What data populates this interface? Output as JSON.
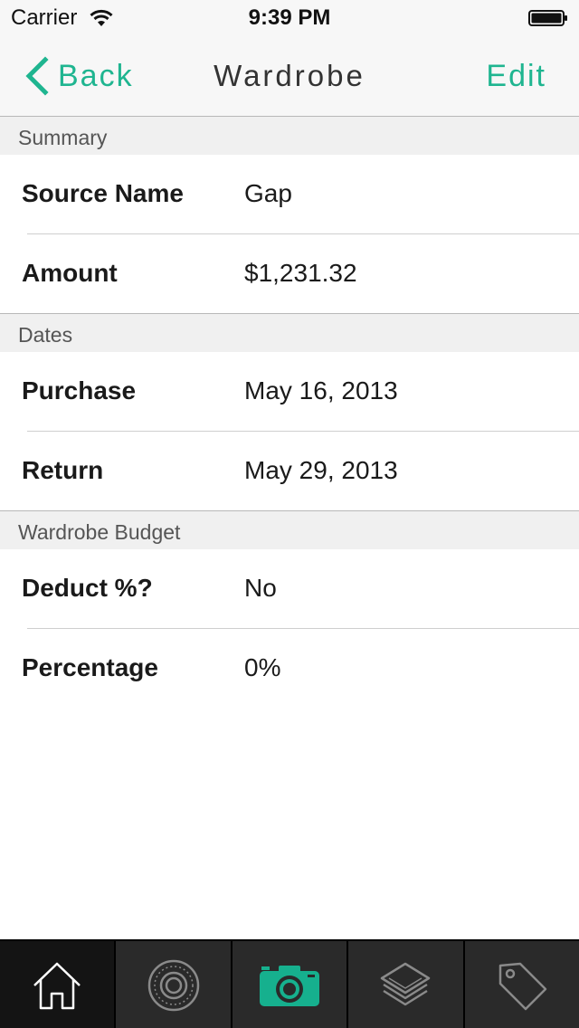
{
  "status_bar": {
    "carrier": "Carrier",
    "time": "9:39 PM"
  },
  "nav": {
    "back_label": "Back",
    "title": "Wardrobe",
    "edit_label": "Edit"
  },
  "sections": {
    "summary": {
      "header": "Summary",
      "source_name_label": "Source Name",
      "source_name_value": "Gap",
      "amount_label": "Amount",
      "amount_value": "$1,231.32"
    },
    "dates": {
      "header": "Dates",
      "purchase_label": "Purchase",
      "purchase_value": "May 16, 2013",
      "return_label": "Return",
      "return_value": "May 29, 2013"
    },
    "budget": {
      "header": "Wardrobe Budget",
      "deduct_label": "Deduct %?",
      "deduct_value": "No",
      "percentage_label": "Percentage",
      "percentage_value": "0%"
    }
  },
  "tab_bar": {
    "tabs": [
      {
        "icon": "home-icon",
        "active": true
      },
      {
        "icon": "dial-icon",
        "active": false
      },
      {
        "icon": "camera-icon",
        "active": false
      },
      {
        "icon": "layers-icon",
        "active": false
      },
      {
        "icon": "tag-icon",
        "active": false
      }
    ]
  },
  "colors": {
    "accent": "#1fb590",
    "camera_accent": "#16b08e",
    "tab_bar_bg": "#2a2a2a",
    "section_header_bg": "#f0f0f0"
  }
}
